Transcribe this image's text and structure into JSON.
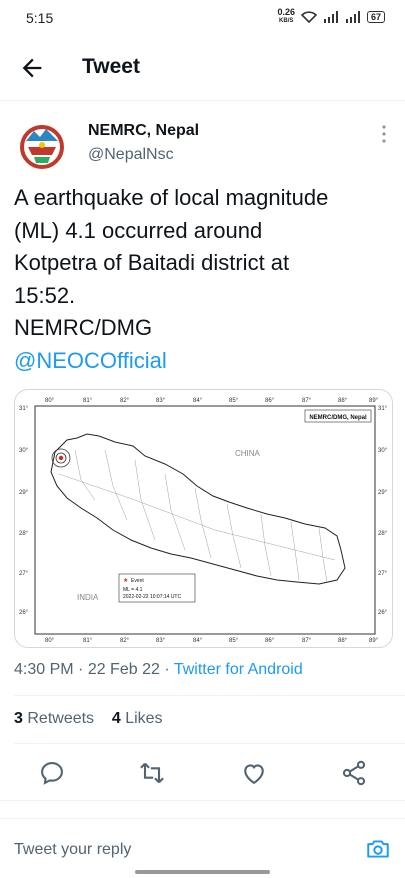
{
  "status_bar": {
    "time": "5:15",
    "net_speed": "0.26",
    "net_unit": "KB/S",
    "battery": "67"
  },
  "header": {
    "title": "Tweet"
  },
  "tweet": {
    "author_name": "NEMRC, Nepal",
    "author_handle": "@NepalNsc",
    "text_lines": [
      "A earthquake of local magnitude",
      "(ML) 4.1 occurred around",
      "Kotpetra of Baitadi district at",
      "15:52.",
      "NEMRC/DMG"
    ],
    "mention": "@NEOCOfficial",
    "time": "4:30 PM",
    "date": "22 Feb 22",
    "source": "Twitter for Android",
    "retweets": "3",
    "retweets_label": "Retweets",
    "likes": "4",
    "likes_label": "Likes"
  },
  "map": {
    "header": "NEMRC/DMG, Nepal",
    "country_north": "CHINA",
    "country_south": "INDIA",
    "x_ticks": [
      "80°",
      "81°",
      "82°",
      "83°",
      "84°",
      "85°",
      "86°",
      "87°",
      "88°",
      "89°"
    ],
    "y_ticks_left": [
      "31°",
      "30°",
      "29°",
      "28°",
      "27°",
      "26°"
    ],
    "y_ticks_right": [
      "31°",
      "30°",
      "29°",
      "28°",
      "27°",
      "26°"
    ],
    "legend_event": "Event",
    "legend_magnitude": "ML = 4.1",
    "legend_datetime": "2022-02-22 10:07:14 UTC",
    "event_color": "#d62728"
  },
  "reply": {
    "placeholder": "Tweet your reply"
  },
  "colors": {
    "accent": "#1d9bf0",
    "secondary_text": "#536471"
  }
}
